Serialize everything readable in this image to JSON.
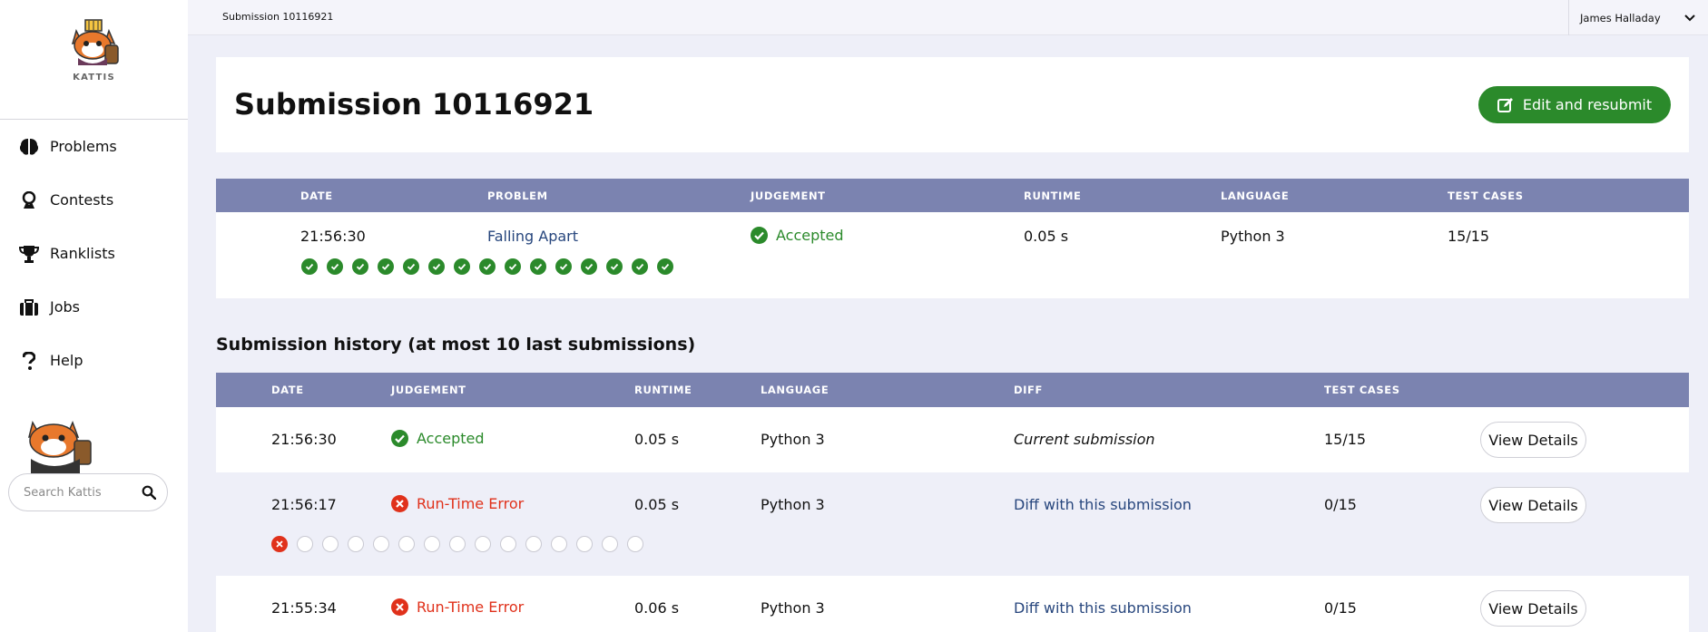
{
  "sidebar": {
    "logo_text": "KATTIS",
    "items": [
      {
        "label": "Problems",
        "icon": "brain-icon"
      },
      {
        "label": "Contests",
        "icon": "contest-icon"
      },
      {
        "label": "Ranklists",
        "icon": "trophy-icon"
      },
      {
        "label": "Jobs",
        "icon": "briefcase-icon"
      },
      {
        "label": "Help",
        "icon": "question-icon"
      }
    ],
    "search_placeholder": "Search Kattis"
  },
  "topbar": {
    "breadcrumb": "Submission 10116921",
    "user_name": "James Halladay"
  },
  "header": {
    "title": "Submission 10116921",
    "edit_button": "Edit and resubmit"
  },
  "submission": {
    "columns": [
      "DATE",
      "PROBLEM",
      "JUDGEMENT",
      "RUNTIME",
      "LANGUAGE",
      "TEST CASES"
    ],
    "date": "21:56:30",
    "problem": "Falling Apart",
    "judgement": "Accepted",
    "runtime": "0.05 s",
    "language": "Python 3",
    "test_cases": "15/15",
    "test_case_results": [
      "pass",
      "pass",
      "pass",
      "pass",
      "pass",
      "pass",
      "pass",
      "pass",
      "pass",
      "pass",
      "pass",
      "pass",
      "pass",
      "pass",
      "pass"
    ]
  },
  "history": {
    "title": "Submission history (at most 10 last submissions)",
    "columns": [
      "DATE",
      "JUDGEMENT",
      "RUNTIME",
      "LANGUAGE",
      "DIFF",
      "TEST CASES"
    ],
    "view_label": "View Details",
    "rows": [
      {
        "date": "21:56:30",
        "judgement": "Accepted",
        "runtime": "0.05 s",
        "language": "Python 3",
        "diff": "Current submission",
        "test_cases": "15/15"
      },
      {
        "date": "21:56:17",
        "judgement": "Run-Time Error",
        "runtime": "0.05 s",
        "language": "Python 3",
        "diff": "Diff with this submission",
        "test_cases": "0/15",
        "test_case_results": [
          "fail",
          "none",
          "none",
          "none",
          "none",
          "none",
          "none",
          "none",
          "none",
          "none",
          "none",
          "none",
          "none",
          "none",
          "none"
        ]
      },
      {
        "date": "21:55:34",
        "judgement": "Run-Time Error",
        "runtime": "0.06 s",
        "language": "Python 3",
        "diff": "Diff with this submission",
        "test_cases": "0/15"
      }
    ]
  },
  "colors": {
    "accent_green": "#2b8a2b",
    "error_red": "#e0311b",
    "table_header": "#7b83b0",
    "link": "#27467d"
  }
}
